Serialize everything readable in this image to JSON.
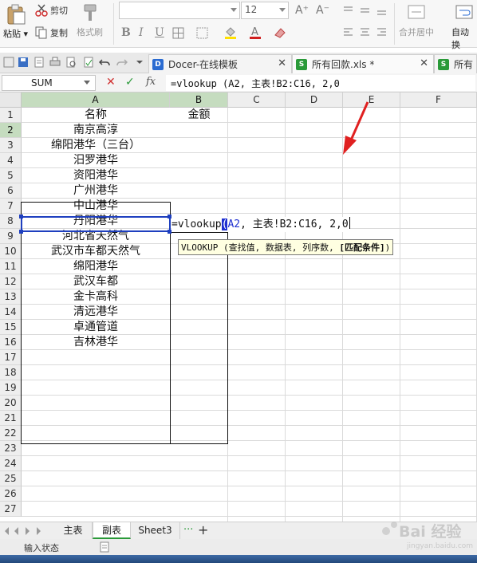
{
  "ribbon": {
    "cut_label": "剪切",
    "paste_label": "粘贴",
    "copy_label": "复制",
    "format_painter_label": "格式刷",
    "font_name": "",
    "font_size": "12",
    "bold": "B",
    "italic": "I",
    "underline": "U",
    "merge_center_label": "合并居中",
    "wrap_label": "自动换"
  },
  "tabs": [
    {
      "label": "Docer-在线模板",
      "icon": "docer-icon"
    },
    {
      "label": "所有回款.xls *",
      "icon": "spreadsheet-icon"
    },
    {
      "label": "所有",
      "icon": "spreadsheet-icon"
    }
  ],
  "formula_bar": {
    "name_box": "SUM",
    "cancel_icon": "cancel-icon",
    "enter_icon": "check-icon",
    "fx": "fx",
    "formula": "=vlookup (A2, 主表!B2:C16, 2,0"
  },
  "columns": [
    "A",
    "B",
    "C",
    "D",
    "E",
    "F"
  ],
  "rows": [
    "1",
    "2",
    "3",
    "4",
    "5",
    "6",
    "7",
    "8",
    "9",
    "10",
    "11",
    "12",
    "13",
    "14",
    "15",
    "16",
    "17",
    "18",
    "19",
    "20",
    "21",
    "22",
    "23",
    "24",
    "25",
    "26",
    "27"
  ],
  "sheet": {
    "header_a": "名称",
    "header_b": "金额",
    "names": [
      "南京高淳",
      "绵阳港华（三台）",
      "汨罗港华",
      "资阳港华",
      "广州港华",
      "中山港华",
      "丹阳港华",
      "河北省天然气",
      "武汉市车都天然气",
      "绵阳港华",
      "武汉车都",
      "金卡高科",
      "清远港华",
      "卓通管道",
      "吉林港华"
    ],
    "editing_cell": {
      "prefix": "=vlookup",
      "paren": "(",
      "rest": "A2, 主表!B2:C16, 2,0"
    },
    "tooltip": {
      "text": "VLOOKUP (查找值, 数据表, 列序数, ",
      "bold": "[匹配条件]",
      "end": ")"
    }
  },
  "sheet_tabs": {
    "tabs": [
      "主表",
      "副表",
      "Sheet3"
    ],
    "active": "副表",
    "more": "···",
    "add": "+"
  },
  "status": {
    "mode": "输入状态"
  },
  "colors": {
    "selection": "#1e3fbf",
    "active_header": "#c5dcbf",
    "tooltip_bg": "#ffffe1",
    "arrow": "#e02020"
  },
  "watermark": {
    "text": "Bai 经验",
    "sub": "jingyan.baidu.com"
  }
}
